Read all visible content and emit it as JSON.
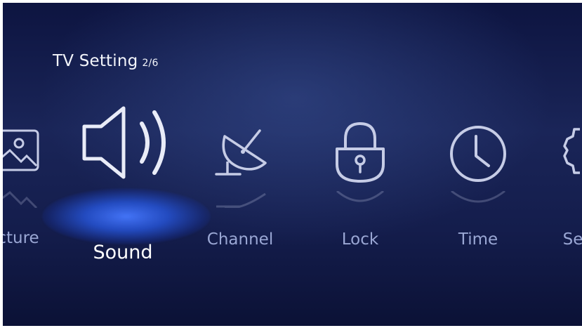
{
  "header": {
    "title": "TV Setting",
    "page_indicator": "2/6"
  },
  "menu": {
    "items": [
      {
        "label": "cture",
        "icon": "picture-icon",
        "selected": false
      },
      {
        "label": "Sound",
        "icon": "speaker-icon",
        "selected": true
      },
      {
        "label": "Channel",
        "icon": "satellite-dish-icon",
        "selected": false
      },
      {
        "label": "Lock",
        "icon": "padlock-icon",
        "selected": false
      },
      {
        "label": "Time",
        "icon": "clock-icon",
        "selected": false
      },
      {
        "label": "Se",
        "icon": "gear-icon",
        "selected": false
      }
    ]
  },
  "colors": {
    "background": "#141d4c",
    "selected_glow": "#3c6cff",
    "label": "#9aa7d4",
    "selected_label": "#ffffff"
  }
}
